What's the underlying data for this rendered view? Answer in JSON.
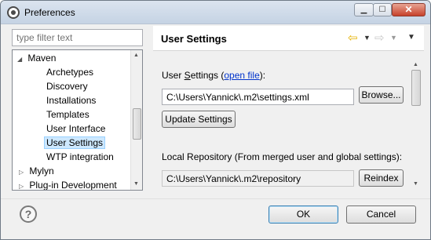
{
  "window": {
    "title": "Preferences"
  },
  "filter": {
    "placeholder": "type filter text"
  },
  "tree": {
    "items": [
      {
        "label": "Maven",
        "expander": "◢"
      },
      {
        "label": "Archetypes"
      },
      {
        "label": "Discovery"
      },
      {
        "label": "Installations"
      },
      {
        "label": "Templates"
      },
      {
        "label": "User Interface"
      },
      {
        "label": "User Settings"
      },
      {
        "label": "WTP integration"
      },
      {
        "label": "Mylyn",
        "expander": "▷"
      },
      {
        "label": "Plug-in Development",
        "expander": "▷"
      }
    ]
  },
  "page": {
    "title": "User Settings",
    "user_settings_label_prefix": "User ",
    "user_settings_label_mnemonic": "S",
    "user_settings_label_rest": "ettings (",
    "open_file_link": "open file",
    "user_settings_label_suffix": "):",
    "settings_path": "C:\\Users\\Yannick\\.m2\\settings.xml",
    "browse_label": "Browse...",
    "update_label": "Update Settings",
    "local_repo_label": "Local Repository (From merged user and global settings):",
    "local_repo_path": "C:\\Users\\Yannick\\.m2\\repository",
    "reindex_label": "Reindex"
  },
  "footer": {
    "ok_label": "OK",
    "cancel_label": "Cancel",
    "help_glyph": "?"
  },
  "icons": {
    "back": "back-arrow-icon",
    "forward": "forward-arrow-icon",
    "view_menu": "view-menu-icon",
    "help": "help-icon",
    "app": "eclipse-app-icon"
  },
  "colors": {
    "link": "#0033cc",
    "selection": "#cde8ff",
    "back_arrow": "#e5b100",
    "close_button": "#c7412a"
  }
}
